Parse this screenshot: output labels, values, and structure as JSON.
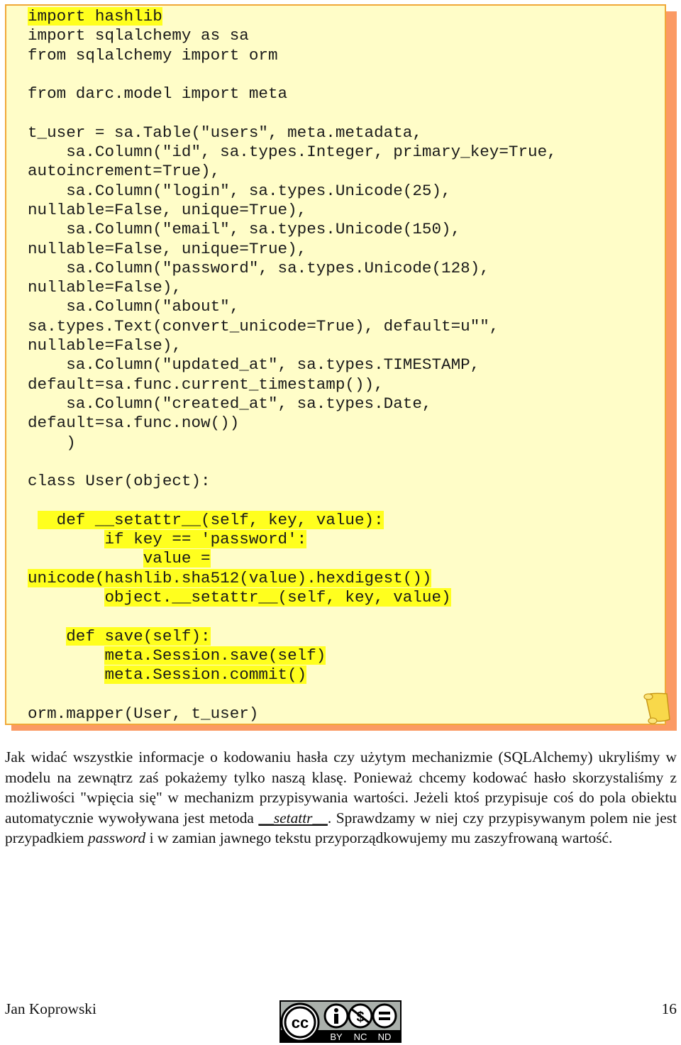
{
  "code_block": {
    "lines": [
      {
        "text": "import hashlib",
        "highlight": "full"
      },
      {
        "text": "import sqlalchemy as sa",
        "highlight": "none"
      },
      {
        "text": "from sqlalchemy import orm",
        "highlight": "none"
      },
      {
        "text": "",
        "highlight": "none"
      },
      {
        "text": "from darc.model import meta",
        "highlight": "none"
      },
      {
        "text": "",
        "highlight": "none"
      },
      {
        "text": "t_user = sa.Table(\"users\", meta.metadata,",
        "highlight": "none"
      },
      {
        "text": "    sa.Column(\"id\", sa.types.Integer, primary_key=True,",
        "highlight": "none"
      },
      {
        "text": "autoincrement=True),",
        "highlight": "none"
      },
      {
        "text": "    sa.Column(\"login\", sa.types.Unicode(25),",
        "highlight": "none"
      },
      {
        "text": "nullable=False, unique=True),",
        "highlight": "none"
      },
      {
        "text": "    sa.Column(\"email\", sa.types.Unicode(150),",
        "highlight": "none"
      },
      {
        "text": "nullable=False, unique=True),",
        "highlight": "none"
      },
      {
        "text": "    sa.Column(\"password\", sa.types.Unicode(128),",
        "highlight": "none"
      },
      {
        "text": "nullable=False),",
        "highlight": "none"
      },
      {
        "text": "    sa.Column(\"about\",",
        "highlight": "none"
      },
      {
        "text": "sa.types.Text(convert_unicode=True), default=u\"\",",
        "highlight": "none"
      },
      {
        "text": "nullable=False),",
        "highlight": "none"
      },
      {
        "text": "    sa.Column(\"updated_at\", sa.types.TIMESTAMP,",
        "highlight": "none"
      },
      {
        "text": "default=sa.func.current_timestamp()),",
        "highlight": "none"
      },
      {
        "text": "    sa.Column(\"created_at\", sa.types.Date,",
        "highlight": "none"
      },
      {
        "text": "default=sa.func.now())",
        "highlight": "none"
      },
      {
        "text": "    )",
        "highlight": "none"
      },
      {
        "text": "",
        "highlight": "none"
      },
      {
        "text": "class User(object):",
        "highlight": "none"
      },
      {
        "text": "",
        "highlight": "none"
      },
      {
        "text": "   def __setattr__(self, key, value):",
        "highlight": "from-3"
      },
      {
        "text": "        if key == 'password':",
        "highlight": "trimmed"
      },
      {
        "text": "            value =",
        "highlight": "trimmed"
      },
      {
        "text": "unicode(hashlib.sha512(value).hexdigest())",
        "highlight": "full"
      },
      {
        "text": "        object.__setattr__(self, key, value)",
        "highlight": "trimmed"
      },
      {
        "text": "",
        "highlight": "none"
      },
      {
        "text": "    def save(self):",
        "highlight": "trimmed"
      },
      {
        "text": "        meta.Session.save(self)",
        "highlight": "trimmed"
      },
      {
        "text": "        meta.Session.commit()",
        "highlight": "trimmed"
      },
      {
        "text": "",
        "highlight": "none"
      },
      {
        "text": "orm.mapper(User, t_user)",
        "highlight": "none"
      }
    ],
    "icon": "scroll-icon",
    "colors": {
      "background": "#fffdc8",
      "border": "#f0a838",
      "shadow": "#fb9a64",
      "highlight": "#ffff1e"
    }
  },
  "paragraph": {
    "part1": "Jak widać wszystkie informacje o kodowaniu hasła czy użytym mechanizmie (SQLAlchemy) ukryliśmy w modelu na zewnątrz zaś pokażemy tylko naszą klasę. Ponieważ chcemy kodować hasło skorzystaliśmy z możliwości \"wpięcia się\" w mechanizm przypisywania wartości. Jeżeli ktoś przypisuje coś do pola obiektu automatycznie wywoływana jest metoda ",
    "method_name": "__setattr__",
    "part2": ". Sprawdzamy w niej  czy przypisywanym polem nie jest przypadkiem ",
    "field_name": "password",
    "part3": " i w zamian jawnego tekstu przyporządkowujemy mu zaszyfrowaną wartość."
  },
  "footer": {
    "author": "Jan Koprowski",
    "page_number": "16",
    "license": {
      "icon": "creative-commons-icon",
      "cc": "cc",
      "labels": [
        "BY",
        "NC",
        "ND"
      ]
    }
  }
}
